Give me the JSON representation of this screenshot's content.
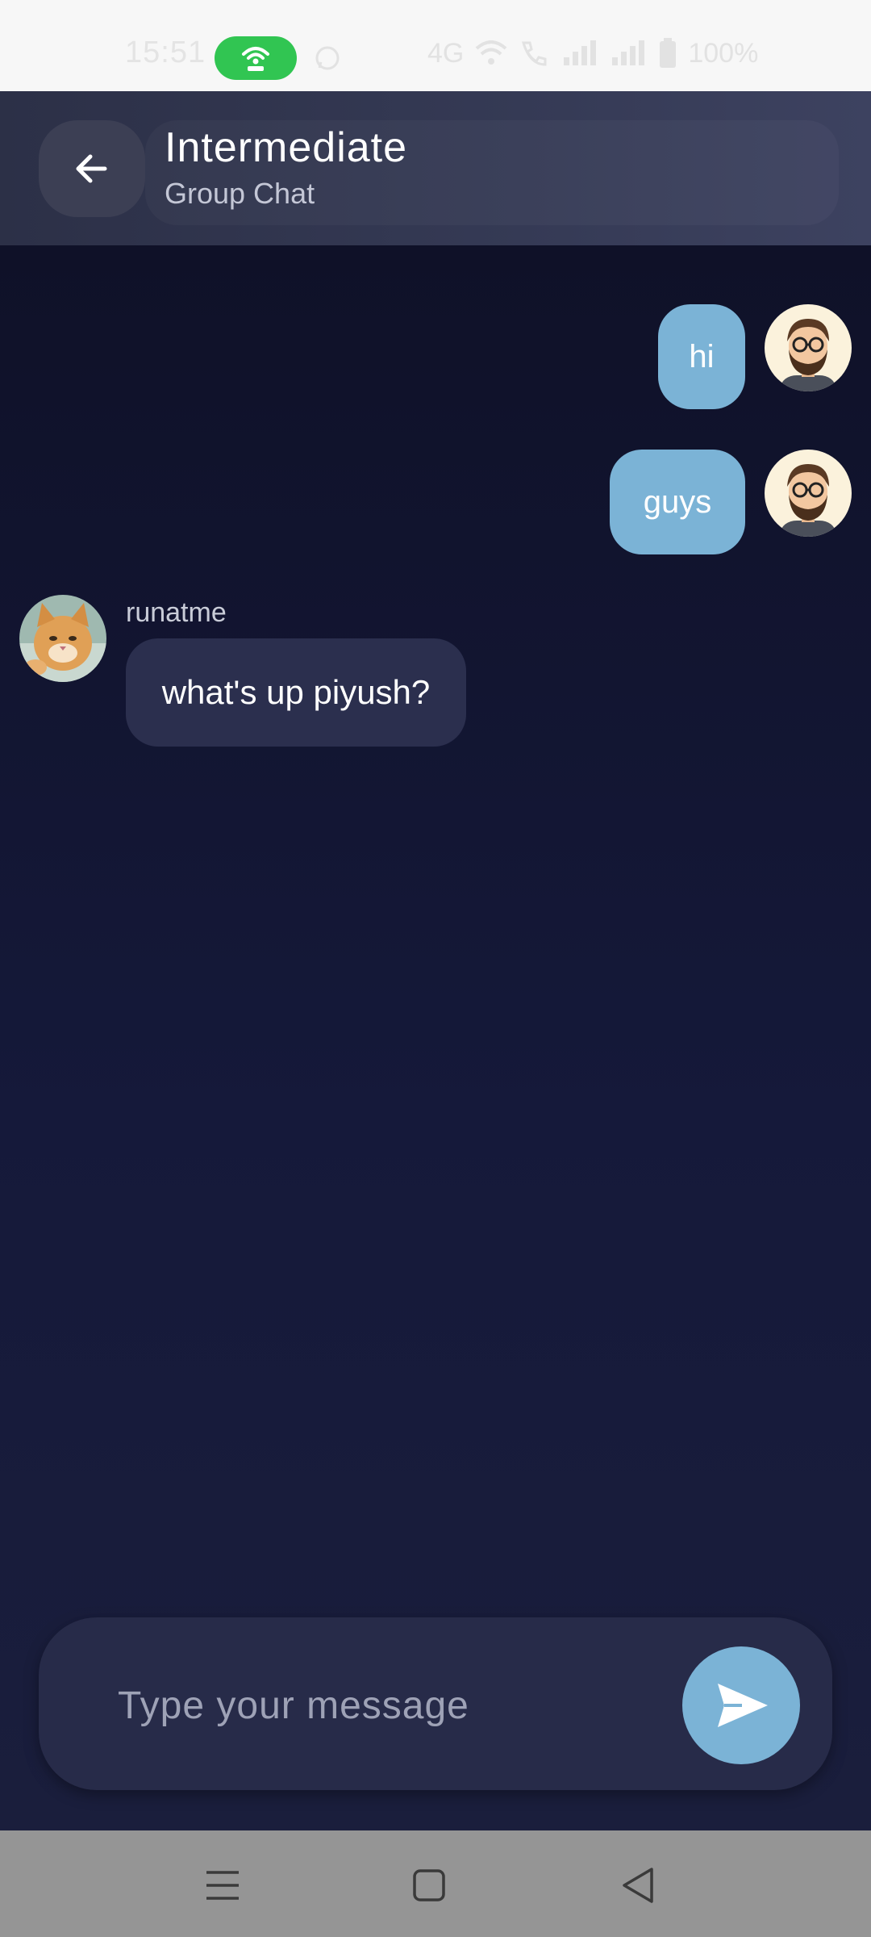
{
  "status_bar": {
    "time": "15:51",
    "network": "4G",
    "battery": "100%",
    "icons": [
      "hotspot-icon",
      "whatsapp-icon",
      "wifi-icon",
      "volte-call-icon",
      "signal-icon",
      "battery-icon"
    ]
  },
  "header": {
    "title": "Intermediate",
    "subtitle": "Group Chat",
    "back_icon": "arrow-left-icon"
  },
  "messages": [
    {
      "direction": "outgoing",
      "text": "hi",
      "avatar": "bearded-man-avatar"
    },
    {
      "direction": "outgoing",
      "text": "guys",
      "avatar": "bearded-man-avatar"
    },
    {
      "direction": "incoming",
      "sender": "runatme",
      "text": "what's up piyush?",
      "avatar": "orange-cat-avatar"
    }
  ],
  "composer": {
    "placeholder": "Type your message",
    "value": "",
    "send_icon": "send-icon"
  },
  "nav_bar": {
    "icons": [
      "menu-icon",
      "home-icon",
      "back-triangle-icon"
    ]
  },
  "colors": {
    "accent": "#7bb3d6",
    "background": "#131632",
    "incoming_bubble": "#2b2f4e",
    "header": "#353a55",
    "hotspot": "#31c552"
  }
}
